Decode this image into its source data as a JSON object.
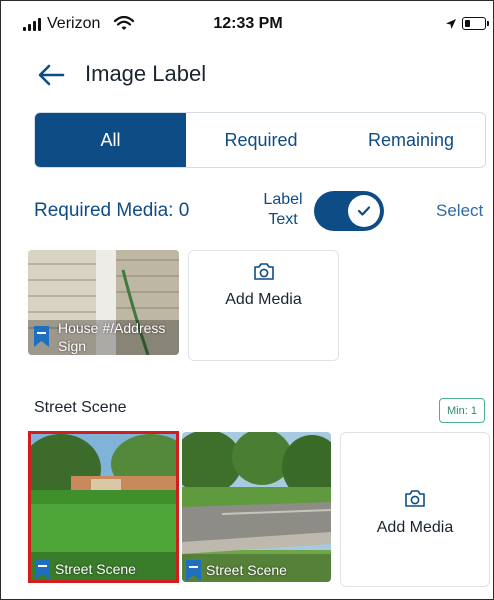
{
  "status_bar": {
    "carrier": "Verizon",
    "time": "12:33 PM"
  },
  "header": {
    "title": "Image Label",
    "back_icon": "arrow-left-icon"
  },
  "tabs": [
    {
      "label": "All",
      "active": true
    },
    {
      "label": "Required",
      "active": false
    },
    {
      "label": "Remaining",
      "active": false
    }
  ],
  "controls": {
    "required_media": "Required Media: 0",
    "label_text": "Label Text",
    "label_text_on": true,
    "select": "Select"
  },
  "first_section": {
    "items": [
      {
        "type": "photo",
        "caption": "House #/Address Sign"
      },
      {
        "type": "add",
        "label": "Add Media"
      }
    ]
  },
  "street_scene": {
    "title": "Street Scene",
    "min_badge": "Min: 1",
    "items": [
      {
        "type": "photo",
        "caption": "Street Scene",
        "selected": true
      },
      {
        "type": "photo",
        "caption": "Street Scene",
        "selected": false
      },
      {
        "type": "add",
        "label": "Add Media"
      }
    ]
  },
  "colors": {
    "primary": "#0e4c86",
    "selected_border": "#d01d1d",
    "min_badge": "#4cb08a"
  }
}
